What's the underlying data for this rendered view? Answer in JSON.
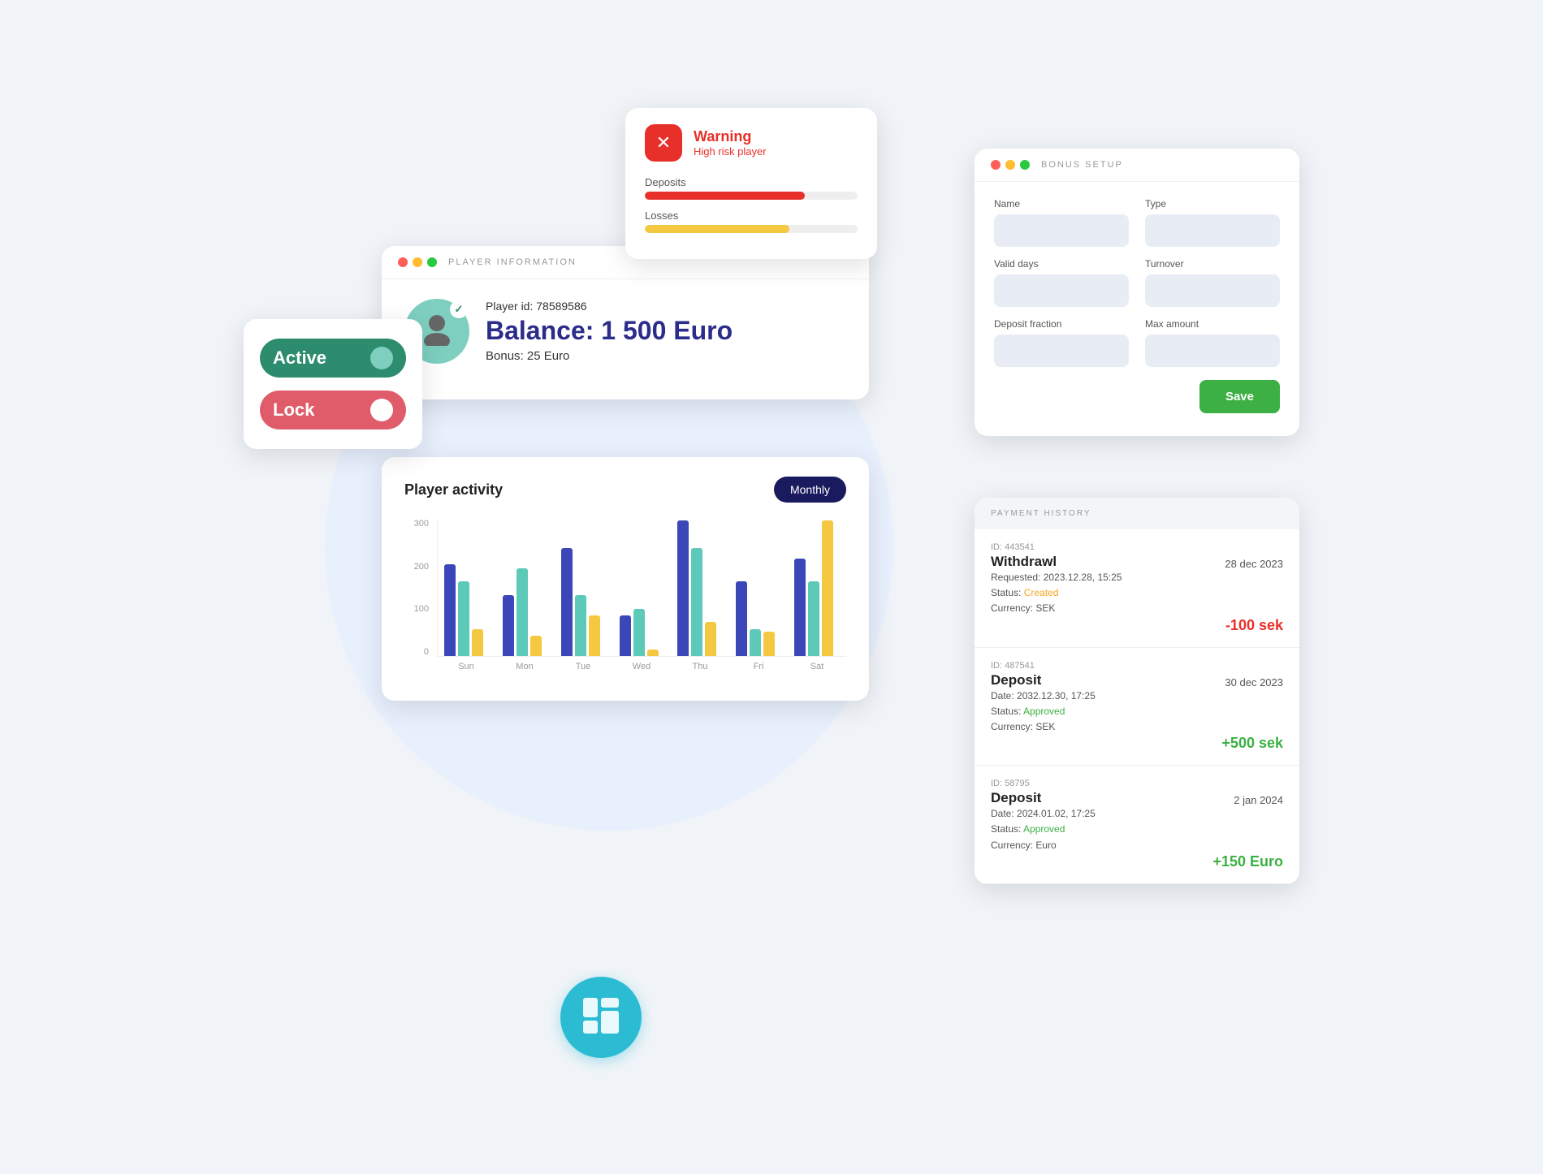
{
  "status_card": {
    "active_label": "Active",
    "lock_label": "Lock"
  },
  "player_info": {
    "titlebar": "PLAYER INFORMATION",
    "player_id": "Player id: 78589586",
    "balance": "Balance: 1 500 Euro",
    "bonus": "Bonus: 25 Euro"
  },
  "activity": {
    "title": "Player activity",
    "button": "Monthly",
    "y_labels": [
      "300",
      "200",
      "100",
      "0"
    ],
    "x_labels": [
      "Sun",
      "Mon",
      "Tue",
      "Wed",
      "Thu",
      "Fri",
      "Sat"
    ],
    "bars": [
      {
        "blue": 68,
        "teal": 55,
        "yellow": 20
      },
      {
        "blue": 45,
        "teal": 65,
        "yellow": 15
      },
      {
        "blue": 80,
        "teal": 45,
        "yellow": 30
      },
      {
        "blue": 30,
        "teal": 35,
        "yellow": 5
      },
      {
        "blue": 100,
        "teal": 80,
        "yellow": 25
      },
      {
        "blue": 55,
        "teal": 20,
        "yellow": 18
      },
      {
        "blue": 72,
        "teal": 55,
        "yellow": 100
      }
    ]
  },
  "warning": {
    "title": "Warning",
    "subtitle": "High risk player",
    "deposits_label": "Deposits",
    "losses_label": "Losses"
  },
  "bonus_setup": {
    "titlebar": "BONUS SETUP",
    "name_label": "Name",
    "type_label": "Type",
    "valid_days_label": "Valid days",
    "turnover_label": "Turnover",
    "deposit_fraction_label": "Deposit fraction",
    "max_amount_label": "Max amount",
    "save_button": "Save"
  },
  "payment_history": {
    "titlebar": "PAYMENT HISTORY",
    "items": [
      {
        "id": "ID: 443541",
        "type": "Withdrawl",
        "date": "28 dec 2023",
        "requested": "Requested: 2023.12.28, 15:25",
        "status_label": "Status:",
        "status": "Created",
        "currency": "Currency: SEK",
        "amount": "-100 sek",
        "amount_type": "neg"
      },
      {
        "id": "ID: 487541",
        "type": "Deposit",
        "date": "30 dec 2023",
        "requested": "Date: 2032.12.30, 17:25",
        "status_label": "Status:",
        "status": "Approved",
        "currency": "Currency: SEK",
        "amount": "+500 sek",
        "amount_type": "pos"
      },
      {
        "id": "ID: 58795",
        "type": "Deposit",
        "date": "2 jan 2024",
        "requested": "Date: 2024.01.02, 17:25",
        "status_label": "Status:",
        "status": "Approved",
        "currency": "Currency: Euro",
        "amount": "+150 Euro",
        "amount_type": "pos"
      }
    ]
  }
}
